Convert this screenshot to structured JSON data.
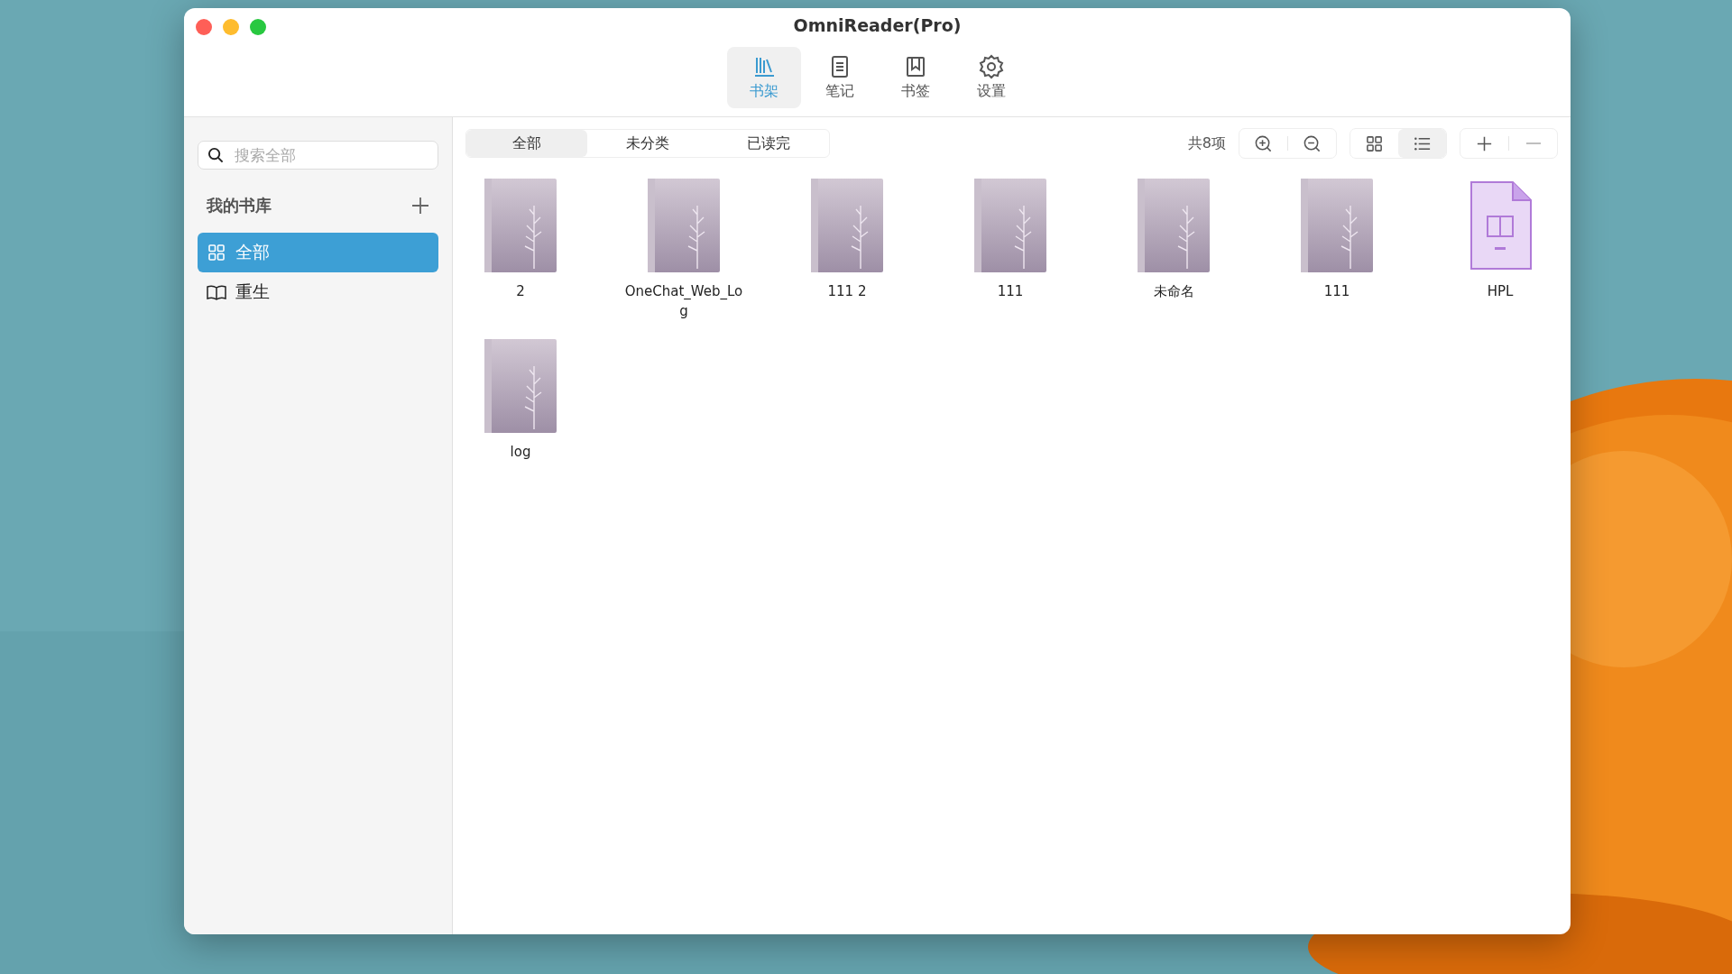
{
  "window": {
    "title": "OmniReader(Pro)"
  },
  "toolbar": [
    {
      "label": "书架",
      "selected": true
    },
    {
      "label": "笔记",
      "selected": false
    },
    {
      "label": "书签",
      "selected": false
    },
    {
      "label": "设置",
      "selected": false
    }
  ],
  "sidebar": {
    "search": {
      "placeholder": "搜索全部"
    },
    "section": "我的书库",
    "items": [
      {
        "label": "全部",
        "selected": true
      },
      {
        "label": "重生",
        "selected": false
      }
    ]
  },
  "filters": [
    {
      "label": "全部",
      "selected": true
    },
    {
      "label": "未分类",
      "selected": false
    },
    {
      "label": "已读完",
      "selected": false
    }
  ],
  "count": "共8项",
  "view": [
    {
      "selected": false
    },
    {
      "selected": true
    }
  ],
  "books": [
    {
      "title": "2",
      "kind": "book"
    },
    {
      "title": "OneChat_Web_Log",
      "kind": "book"
    },
    {
      "title": "111 2",
      "kind": "book"
    },
    {
      "title": "111",
      "kind": "book"
    },
    {
      "title": "未命名",
      "kind": "book"
    },
    {
      "title": "111",
      "kind": "book"
    },
    {
      "title": "HPL",
      "kind": "file"
    },
    {
      "title": "log",
      "kind": "book"
    }
  ]
}
